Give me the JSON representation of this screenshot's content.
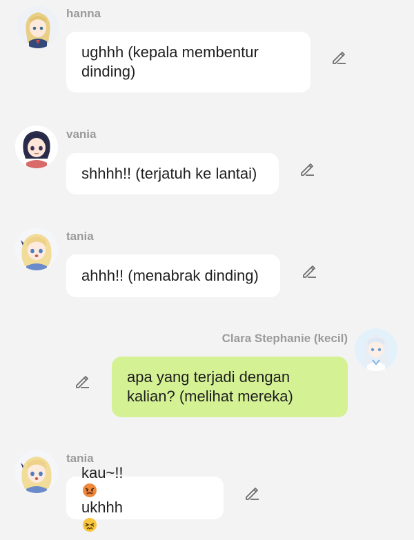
{
  "messages": [
    {
      "sender": "hanna",
      "text": "ughhh (kepala membentur dinding)",
      "avatar_icon": "blonde-girl-avatar"
    },
    {
      "sender": "vania",
      "text": "shhhh!! (terjatuh ke lantai)",
      "avatar_icon": "dark-hair-girl-avatar"
    },
    {
      "sender": "tania",
      "text": "ahhh!! (menabrak dinding)",
      "avatar_icon": "blonde-girl-avatar"
    },
    {
      "sender": "Clara Stephanie (kecil)",
      "text": "apa yang terjadi dengan kalian? (melihat mereka)",
      "avatar_icon": "white-hair-girl-avatar"
    },
    {
      "sender": "tania",
      "text_part1": "kau~!!",
      "emoji1": "angry-face-emoji",
      "text_part2": " ukhhh",
      "emoji2": "persevering-face-emoji",
      "avatar_icon": "blonde-girl-avatar"
    }
  ],
  "colors": {
    "background": "#f3f3f3",
    "bubble_incoming": "#ffffff",
    "bubble_outgoing": "#d4f194",
    "sender_name": "#9a9a9a",
    "edit_icon": "#6d6d6d"
  },
  "icons": {
    "edit": "pencil-edit-icon"
  }
}
